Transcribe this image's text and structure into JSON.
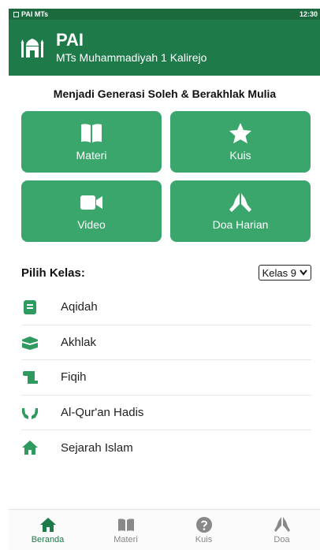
{
  "status_bar": {
    "app_name": "PAI MTs",
    "time": "12:30"
  },
  "header": {
    "title": "PAI",
    "subtitle": "MTs Muhammadiyah 1 Kalirejo"
  },
  "tagline": "Menjadi Generasi Soleh & Berakhlak Mulia",
  "menu": [
    {
      "label": "Materi",
      "icon": "book-icon"
    },
    {
      "label": "Kuis",
      "icon": "star-icon"
    },
    {
      "label": "Video",
      "icon": "video-camera-icon"
    },
    {
      "label": "Doa Harian",
      "icon": "praying-hands-icon"
    }
  ],
  "kelas": {
    "title": "Pilih Kelas:",
    "selected": "Kelas 9"
  },
  "subjects": [
    {
      "label": "Aqidah",
      "icon": "book-quran-icon"
    },
    {
      "label": "Akhlak",
      "icon": "kaaba-icon"
    },
    {
      "label": "Fiqih",
      "icon": "scroll-icon"
    },
    {
      "label": "Al-Qur'an Hadis",
      "icon": "hands-icon"
    },
    {
      "label": "Sejarah Islam",
      "icon": "home-icon"
    }
  ],
  "bottom_nav": [
    {
      "label": "Beranda",
      "icon": "home-icon",
      "active": true
    },
    {
      "label": "Materi",
      "icon": "book-icon",
      "active": false
    },
    {
      "label": "Kuis",
      "icon": "question-circle-icon",
      "active": false
    },
    {
      "label": "Doa",
      "icon": "praying-hands-icon",
      "active": false
    }
  ],
  "colors": {
    "primary": "#1f7a4a",
    "tile": "#3aa66c",
    "status_bar": "#1a6a3e",
    "inactive_nav": "#888888"
  }
}
